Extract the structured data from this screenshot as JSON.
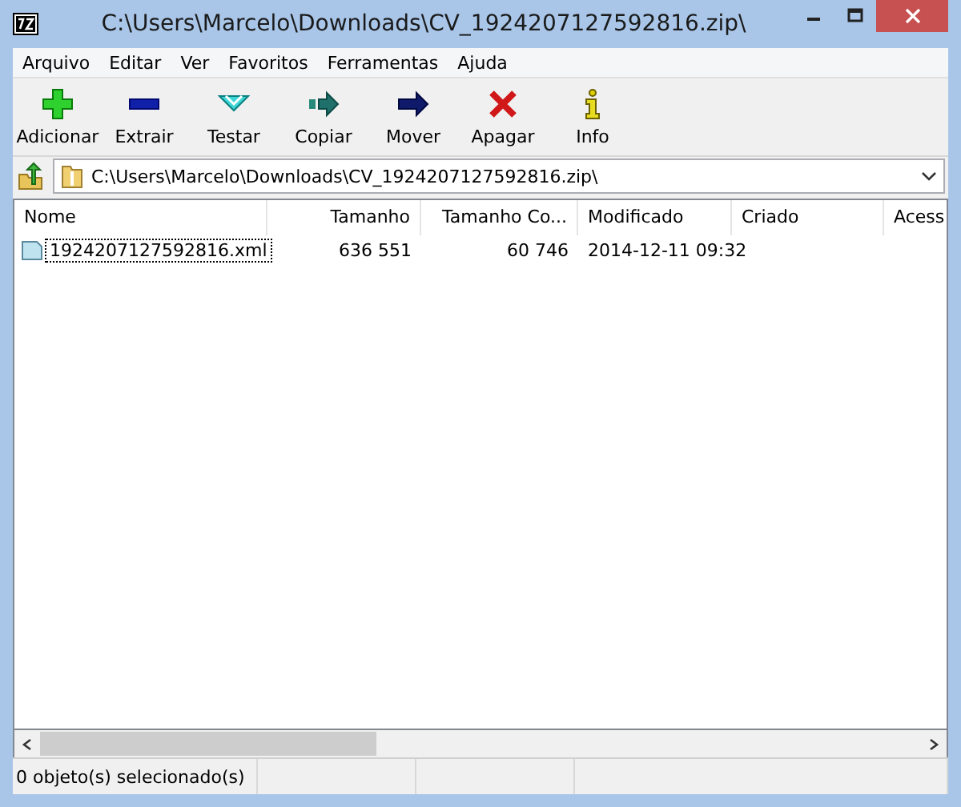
{
  "window": {
    "title": "C:\\Users\\Marcelo\\Downloads\\CV_1924207127592816.zip\\"
  },
  "menu": [
    "Arquivo",
    "Editar",
    "Ver",
    "Favoritos",
    "Ferramentas",
    "Ajuda"
  ],
  "toolbar": [
    {
      "kind": "add",
      "label": "Adicionar"
    },
    {
      "kind": "extract",
      "label": "Extrair"
    },
    {
      "kind": "test",
      "label": "Testar"
    },
    {
      "kind": "copy",
      "label": "Copiar"
    },
    {
      "kind": "move",
      "label": "Mover"
    },
    {
      "kind": "delete",
      "label": "Apagar"
    },
    {
      "kind": "info",
      "label": "Info"
    }
  ],
  "address": {
    "value": "C:\\Users\\Marcelo\\Downloads\\CV_1924207127592816.zip\\"
  },
  "table": {
    "columns": [
      "Nome",
      "Tamanho",
      "Tamanho Co...",
      "Modificado",
      "Criado",
      "Acess"
    ],
    "rows": [
      {
        "focused": true,
        "cells": [
          "1924207127592816.xml",
          "636 551",
          "60 746",
          "2014-12-11 09:32",
          "",
          ""
        ]
      }
    ]
  },
  "status_bar": {
    "text": "0 objeto(s) selecionado(s)"
  }
}
